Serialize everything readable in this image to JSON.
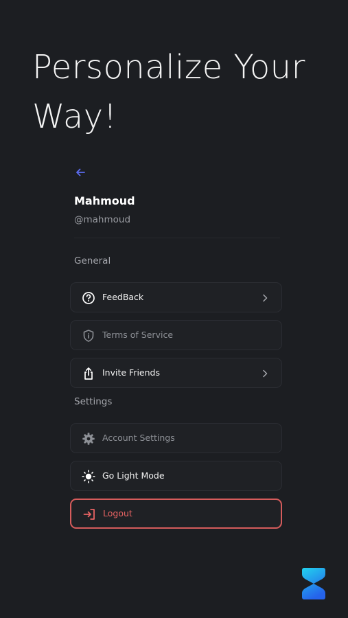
{
  "headline": "Personalize Your Way!",
  "profile": {
    "name": "Mahmoud",
    "handle": "@mahmoud"
  },
  "sections": {
    "general": "General",
    "settings": "Settings"
  },
  "menu": {
    "feedback": "FeedBack",
    "terms": "Terms of Service",
    "invite": "Invite Friends",
    "account_settings": "Account Settings",
    "light_mode": "Go Light Mode",
    "logout": "Logout"
  },
  "icons": {
    "back": "arrow-left-icon",
    "feedback": "question-circle-icon",
    "terms": "shield-info-icon",
    "invite": "share-upload-icon",
    "account_settings": "gear-icon",
    "light_mode": "sun-icon",
    "logout": "login-arrow-icon",
    "chevron": "chevron-right-icon",
    "brand": "brand-logo-icon"
  },
  "colors": {
    "background": "#1c1e22",
    "accent": "#5b6cf0",
    "danger": "#e05f5f",
    "brand_gradient": [
      "#22d3ee",
      "#2563eb"
    ]
  }
}
